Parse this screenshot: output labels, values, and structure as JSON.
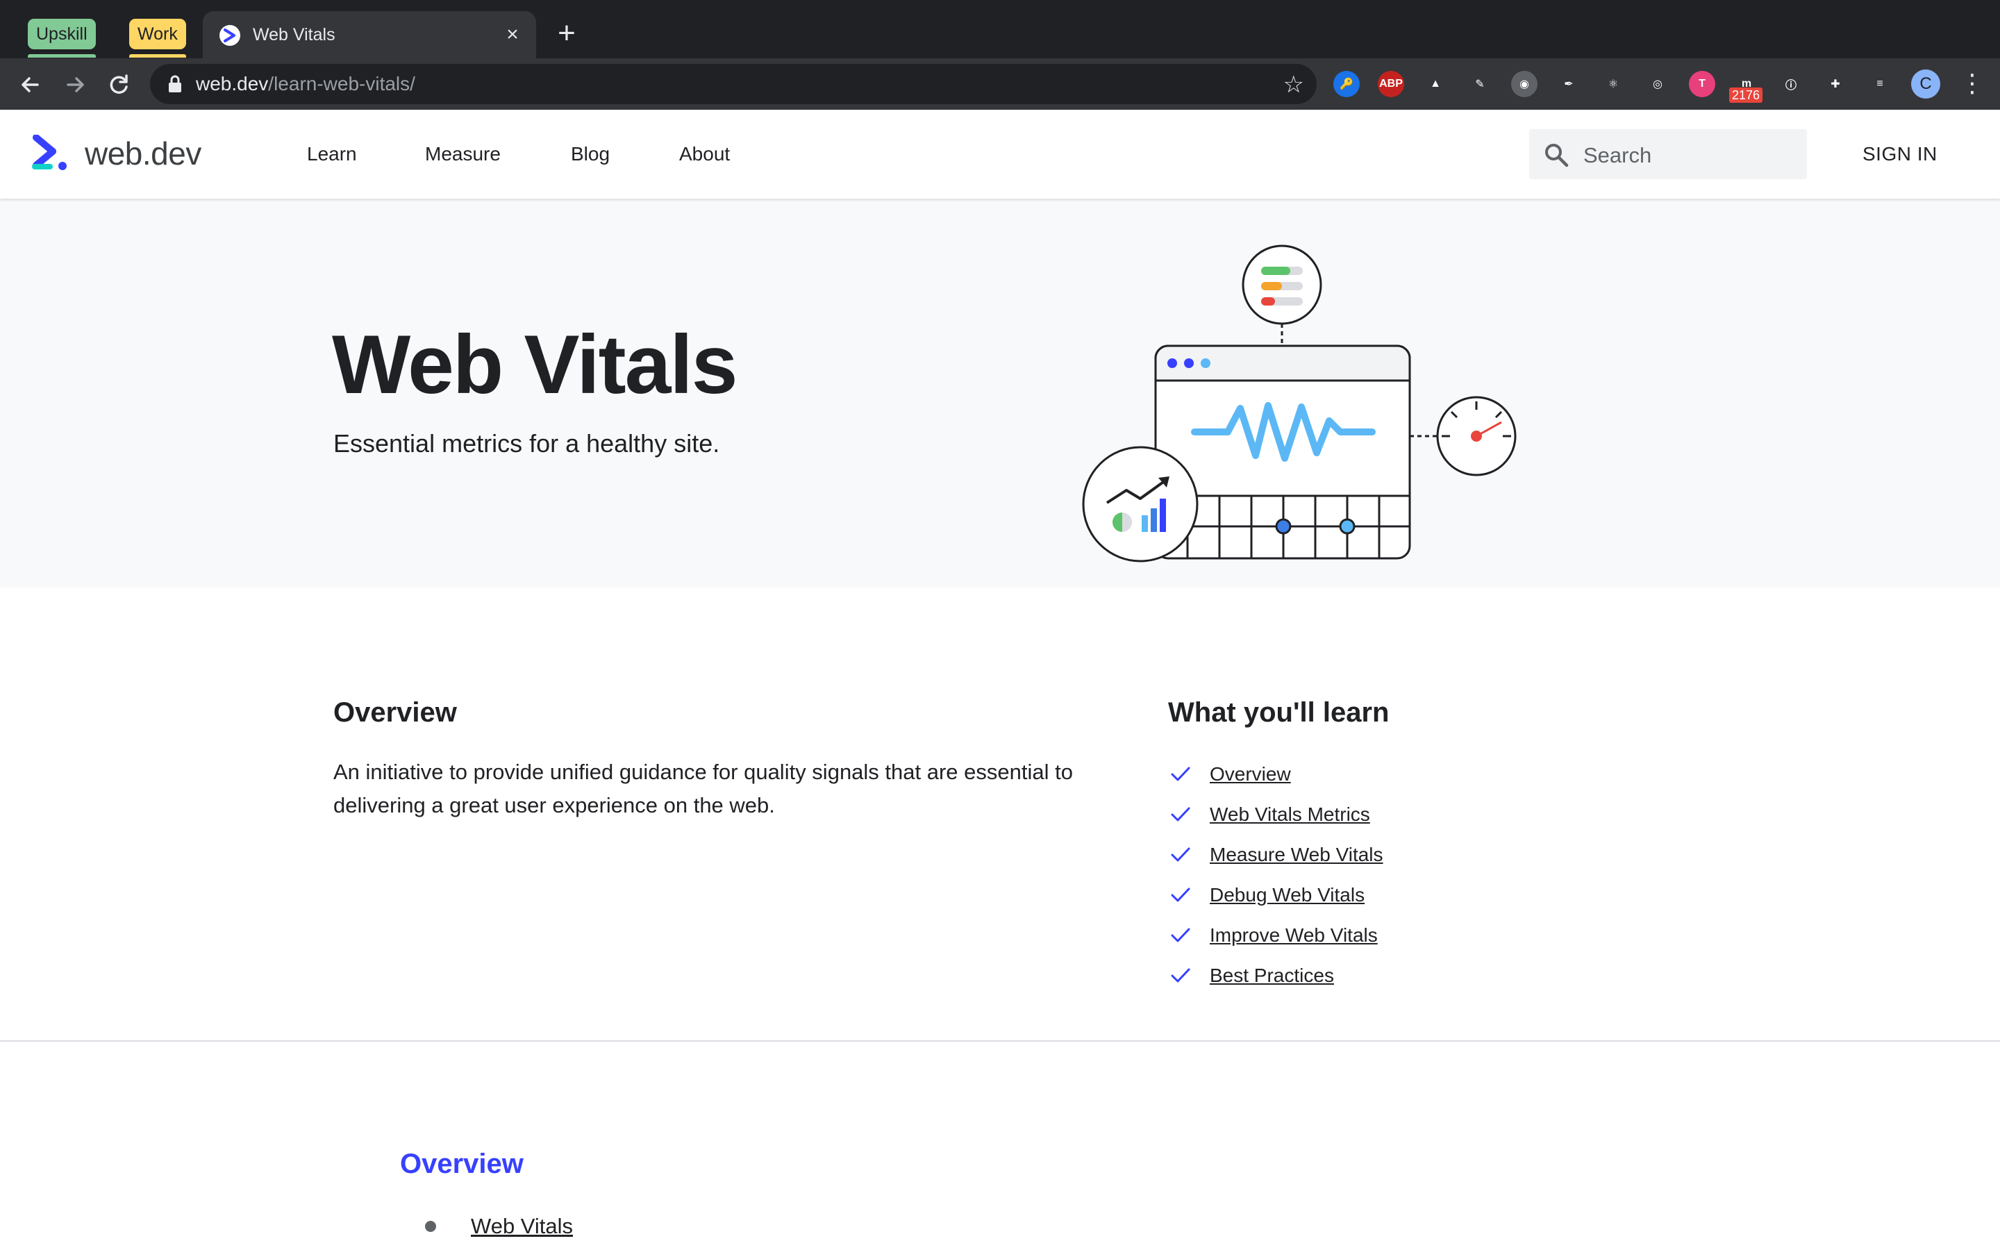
{
  "browser": {
    "tab_groups": [
      {
        "label": "Upskill",
        "color": "#81c995"
      },
      {
        "label": "Work",
        "color": "#fdd663"
      }
    ],
    "active_tab": {
      "title": "Web Vitals",
      "close_glyph": "×"
    },
    "new_tab_glyph": "+",
    "url_host": "web.dev",
    "url_path": "/learn-web-vitals/",
    "extensions": [
      {
        "name": "1password-icon",
        "glyph": "🔑",
        "bg": "#1a73e8"
      },
      {
        "name": "adblock-plus-icon",
        "glyph": "ABP",
        "bg": "#c5221f"
      },
      {
        "name": "triangle-ext-icon",
        "glyph": "▲",
        "bg": "#35363a"
      },
      {
        "name": "pen-ext-icon",
        "glyph": "✎",
        "bg": "#35363a"
      },
      {
        "name": "camera-ext-icon",
        "glyph": "◉",
        "bg": "#5f6368"
      },
      {
        "name": "feather-ext-icon",
        "glyph": "✒",
        "bg": "#35363a"
      },
      {
        "name": "react-devtools-icon",
        "glyph": "⚛",
        "bg": "#35363a"
      },
      {
        "name": "target-ext-icon",
        "glyph": "◎",
        "bg": "#35363a"
      },
      {
        "name": "pink-t-ext-icon",
        "glyph": "T",
        "bg": "#e8407a"
      },
      {
        "name": "m-ext-icon",
        "glyph": "m",
        "bg": "#35363a"
      },
      {
        "name": "fingerprint-ext-icon",
        "glyph": "ⓘ",
        "bg": "#35363a"
      },
      {
        "name": "extensions-puzzle-icon",
        "glyph": "✚",
        "bg": "#35363a"
      },
      {
        "name": "reading-list-icon",
        "glyph": "≡",
        "bg": "#35363a"
      }
    ],
    "extension_badge": "2176",
    "profile_initial": "C",
    "menu_glyph": "⋮"
  },
  "site": {
    "logo_text": "web.dev",
    "nav": [
      "Learn",
      "Measure",
      "Blog",
      "About"
    ],
    "search_placeholder": "Search",
    "sign_in": "SIGN IN"
  },
  "hero": {
    "title": "Web Vitals",
    "subtitle": "Essential metrics for a healthy site."
  },
  "overview": {
    "title": "Overview",
    "body": "An initiative to provide unified guidance for quality signals that are essential to delivering a great user experience on the web."
  },
  "learn": {
    "title": "What you'll learn",
    "items": [
      "Overview",
      "Web Vitals Metrics",
      "Measure Web Vitals",
      "Debug Web Vitals",
      "Improve Web Vitals",
      "Best Practices"
    ]
  },
  "toc": {
    "title": "Overview",
    "items": [
      "Web Vitals"
    ]
  },
  "colors": {
    "accent": "#3740ff",
    "check": "#3740ff"
  }
}
